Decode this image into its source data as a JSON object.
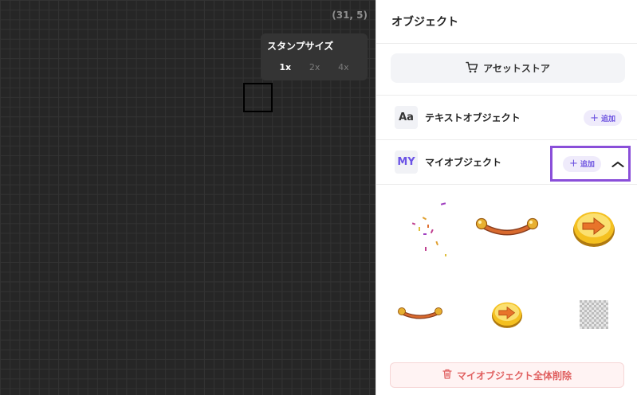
{
  "canvas": {
    "coords": "(31, 5)",
    "stamp": {
      "title": "スタンプサイズ",
      "sizes": [
        "1x",
        "2x",
        "4x"
      ],
      "selected": "1x"
    }
  },
  "panel": {
    "title": "オブジェクト",
    "store_label": "アセットストア",
    "text_object": {
      "icon": "Aa",
      "label": "テキストオブジェクト",
      "add_label": "追加"
    },
    "my_object": {
      "icon": "MY",
      "label": "マイオブジェクト",
      "add_label": "追加"
    },
    "objects": [
      {
        "name": "confetti-object"
      },
      {
        "name": "bar-object"
      },
      {
        "name": "arrow-button-object"
      },
      {
        "name": "bar-object-small"
      },
      {
        "name": "arrow-button-object-small"
      },
      {
        "name": "transparent-object"
      }
    ],
    "delete_all_label": "マイオブジェクト全体削除"
  },
  "colors": {
    "accent": "#6c52e0",
    "highlight": "#8a4fd9",
    "danger": "#e06060"
  }
}
